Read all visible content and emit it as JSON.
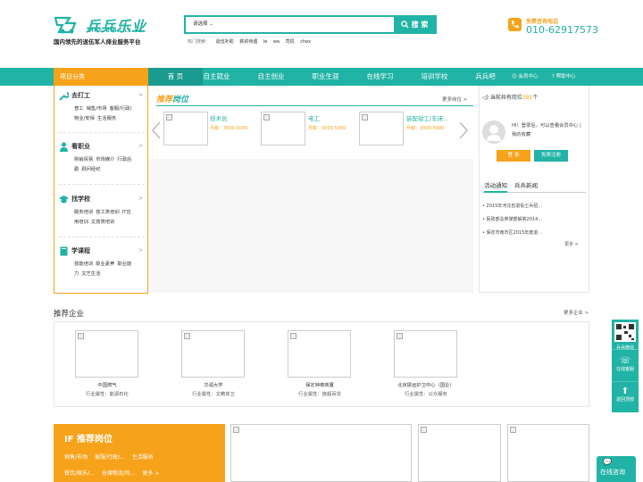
{
  "brand": {
    "name": "兵兵乐业",
    "pinyin": "BING BING LE YE",
    "slogan": "国内领先的退伍军人择业服务平台"
  },
  "search": {
    "select": "请选择",
    "placeholder": "",
    "button": "搜 索",
    "hot_label": "热门搜索：",
    "hot_terms": [
      "退伍补助",
      "薪资待遇",
      "le",
      "wa",
      "司机",
      "chex"
    ]
  },
  "hotline": {
    "label": "免费咨询电话",
    "number": "010-62917573"
  },
  "nav": {
    "category": "项目分类",
    "items": [
      "首 页",
      "自主就业",
      "自主创业",
      "职业生涯",
      "在线学习",
      "培训学校",
      "兵兵吧"
    ],
    "user": "会员中心",
    "help": "帮助中心"
  },
  "sidebar": [
    {
      "title": "去打工",
      "links": [
        "普工",
        "销售/市场",
        "客服/行政/",
        "物业/安保",
        "生活服务"
      ]
    },
    {
      "title": "看职业",
      "links": [
        "购销贸易",
        "市场媒介",
        "行政后",
        "勤",
        "顾问经纪"
      ]
    },
    {
      "title": "找学校",
      "links": [
        "服务培训",
        "技工类培训",
        "IT应",
        "用培训",
        "文技类培训"
      ]
    },
    {
      "title": "学课程",
      "links": [
        "技能培训",
        "职业素养",
        "职业能",
        "力",
        "文艺生活"
      ]
    }
  ],
  "recommend": {
    "title_a": "推荐",
    "title_b": "岗位",
    "more": "更多岗位 >",
    "jobs": [
      {
        "name": "技术员",
        "salary": "月薪：3000-5000"
      },
      {
        "name": "电工",
        "salary": "月薪：3000-5000"
      },
      {
        "name": "装配钳工/车床...",
        "salary": "月薪：3000-5000"
      }
    ]
  },
  "right": {
    "count_label": "当前共有岗位",
    "count": "381",
    "count_unit": "个",
    "welcome": "Hi！登录后，可以查看会员中心 | 我的收藏",
    "login": "登 录",
    "register": "免费注册",
    "tabs": [
      "活动通知",
      "兵兵新闻"
    ],
    "news": [
      "• 2015年河北省退役士兵招...",
      "• 民政部总参谋部解答2014...",
      "• 保定市南市区2015年度退..."
    ],
    "more": "更多 >"
  },
  "enterprise": {
    "title": "推荐企业",
    "more": "更多企业 >",
    "items": [
      {
        "name": "中国燃气",
        "industry": "行业属性：能源石化"
      },
      {
        "name": "华润大学",
        "industry": "行业属性：文教体卫"
      },
      {
        "name": "保定钟楼商厦",
        "industry": "行业属性：旅超百货"
      },
      {
        "name": "北京振远护卫中心（国企）",
        "industry": "行业属性：公众服务"
      }
    ]
  },
  "bottom": {
    "title": "推荐岗位",
    "prefix": "IF",
    "row1": [
      "销售/市场",
      "客服/行政/...",
      "生活服务"
    ],
    "row2": [
      "餐饮/娱乐/...",
      "仓储物流/司...",
      "更多 >"
    ]
  },
  "float": {
    "items": [
      "兵兵微信",
      "在线客服",
      "返回顶部"
    ],
    "online": "在线咨询"
  }
}
